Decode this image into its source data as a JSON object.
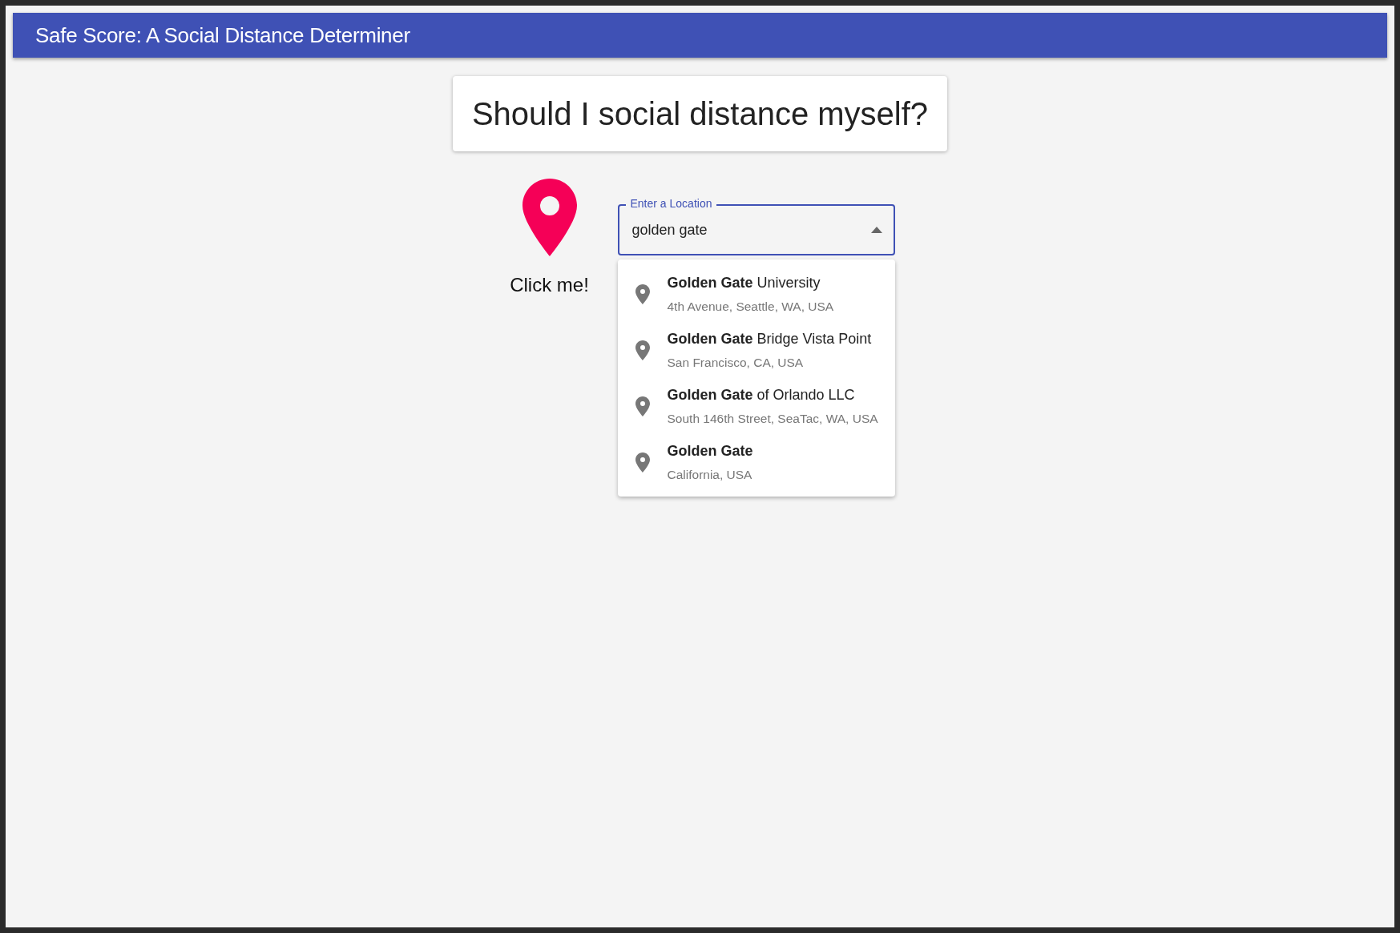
{
  "app_bar": {
    "title": "Safe Score: A Social Distance Determiner"
  },
  "question_card": {
    "text": "Should I social distance myself?"
  },
  "locate_button": {
    "label": "Click me!"
  },
  "location_field": {
    "label": "Enter a Location",
    "value": "golden gate ",
    "expanded": true
  },
  "suggestions": [
    {
      "main": "**Golden Gate** University",
      "secondary": "4th Avenue, Seattle, WA, USA"
    },
    {
      "main": "**Golden Gate** Bridge Vista Point",
      "secondary": "San Francisco, CA, USA"
    },
    {
      "main": "**Golden Gate** of Orlando LLC",
      "secondary": "South 146th Street, SeaTac, WA, USA"
    },
    {
      "main": "**Golden Gate**",
      "secondary": "California, USA"
    }
  ]
}
